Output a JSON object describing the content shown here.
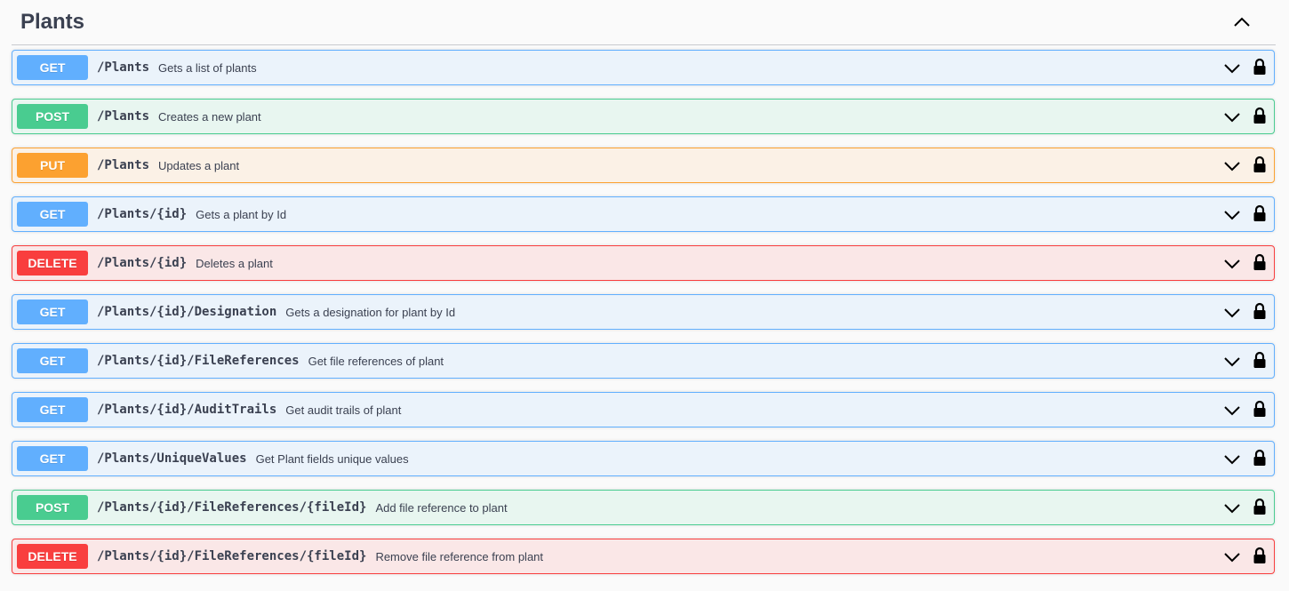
{
  "section": {
    "title": "Plants",
    "collapse_icon": "chevron-up-icon"
  },
  "colors": {
    "get": "#61affe",
    "post": "#49cc90",
    "put": "#fca130",
    "delete": "#f93e3e"
  },
  "operations": [
    {
      "method": "GET",
      "path": "/Plants",
      "summary": "Gets a list of plants"
    },
    {
      "method": "POST",
      "path": "/Plants",
      "summary": "Creates a new plant"
    },
    {
      "method": "PUT",
      "path": "/Plants",
      "summary": "Updates a plant"
    },
    {
      "method": "GET",
      "path": "/Plants/{id}",
      "summary": "Gets a plant by Id"
    },
    {
      "method": "DELETE",
      "path": "/Plants/{id}",
      "summary": "Deletes a plant"
    },
    {
      "method": "GET",
      "path": "/Plants/{id}/Designation",
      "summary": "Gets a designation for plant by Id"
    },
    {
      "method": "GET",
      "path": "/Plants/{id}/FileReferences",
      "summary": "Get file references of plant"
    },
    {
      "method": "GET",
      "path": "/Plants/{id}/AuditTrails",
      "summary": "Get audit trails of plant"
    },
    {
      "method": "GET",
      "path": "/Plants/UniqueValues",
      "summary": "Get Plant fields unique values"
    },
    {
      "method": "POST",
      "path": "/Plants/{id}/FileReferences/{fileId}",
      "summary": "Add file reference to plant"
    },
    {
      "method": "DELETE",
      "path": "/Plants/{id}/FileReferences/{fileId}",
      "summary": "Remove file reference from plant"
    }
  ],
  "row_icons": {
    "expand": "chevron-down-icon",
    "auth": "lock-icon"
  }
}
